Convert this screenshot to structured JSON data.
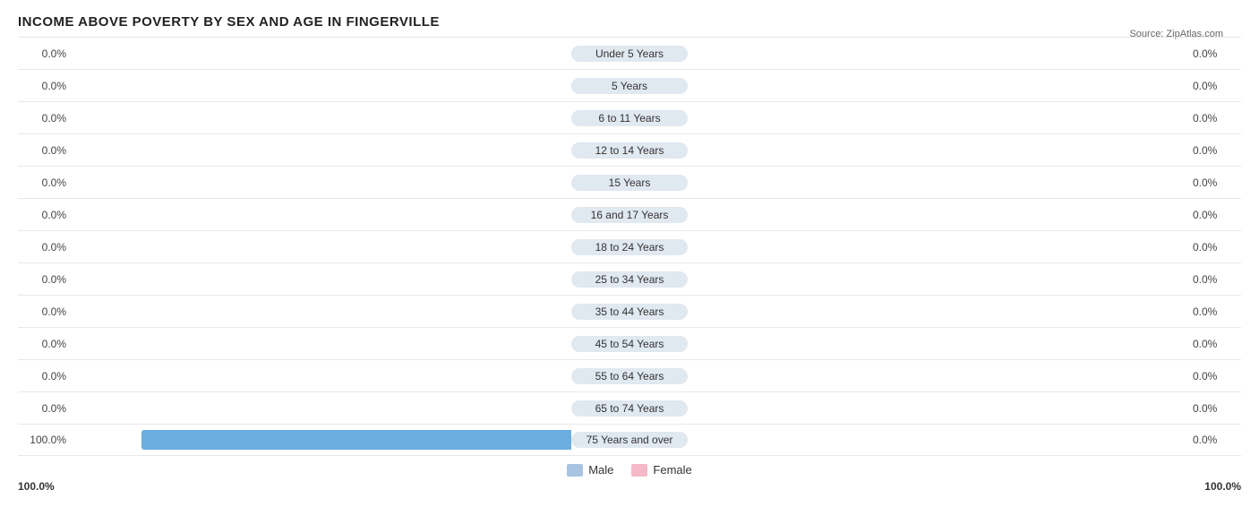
{
  "title": "INCOME ABOVE POVERTY BY SEX AND AGE IN FINGERVILLE",
  "source": "Source: ZipAtlas.com",
  "rows": [
    {
      "label": "Under 5 Years",
      "male_val": "0.0%",
      "female_val": "0.0%",
      "male_pct": 0,
      "female_pct": 0
    },
    {
      "label": "5 Years",
      "male_val": "0.0%",
      "female_val": "0.0%",
      "male_pct": 0,
      "female_pct": 0
    },
    {
      "label": "6 to 11 Years",
      "male_val": "0.0%",
      "female_val": "0.0%",
      "male_pct": 0,
      "female_pct": 0
    },
    {
      "label": "12 to 14 Years",
      "male_val": "0.0%",
      "female_val": "0.0%",
      "male_pct": 0,
      "female_pct": 0
    },
    {
      "label": "15 Years",
      "male_val": "0.0%",
      "female_val": "0.0%",
      "male_pct": 0,
      "female_pct": 0
    },
    {
      "label": "16 and 17 Years",
      "male_val": "0.0%",
      "female_val": "0.0%",
      "male_pct": 0,
      "female_pct": 0
    },
    {
      "label": "18 to 24 Years",
      "male_val": "0.0%",
      "female_val": "0.0%",
      "male_pct": 0,
      "female_pct": 0
    },
    {
      "label": "25 to 34 Years",
      "male_val": "0.0%",
      "female_val": "0.0%",
      "male_pct": 0,
      "female_pct": 0
    },
    {
      "label": "35 to 44 Years",
      "male_val": "0.0%",
      "female_val": "0.0%",
      "male_pct": 0,
      "female_pct": 0
    },
    {
      "label": "45 to 54 Years",
      "male_val": "0.0%",
      "female_val": "0.0%",
      "male_pct": 0,
      "female_pct": 0
    },
    {
      "label": "55 to 64 Years",
      "male_val": "0.0%",
      "female_val": "0.0%",
      "male_pct": 0,
      "female_pct": 0
    },
    {
      "label": "65 to 74 Years",
      "male_val": "0.0%",
      "female_val": "0.0%",
      "male_pct": 0,
      "female_pct": 0
    },
    {
      "label": "75 Years and over",
      "male_val": "100.0%",
      "female_val": "0.0%",
      "male_pct": 100,
      "female_pct": 0
    }
  ],
  "legend": {
    "male_label": "Male",
    "female_label": "Female",
    "male_color": "#a8c4e0",
    "female_color": "#f4b8c8"
  },
  "bottom_left": "100.0%",
  "bottom_right": "100.0%",
  "max_bar_width": 480
}
